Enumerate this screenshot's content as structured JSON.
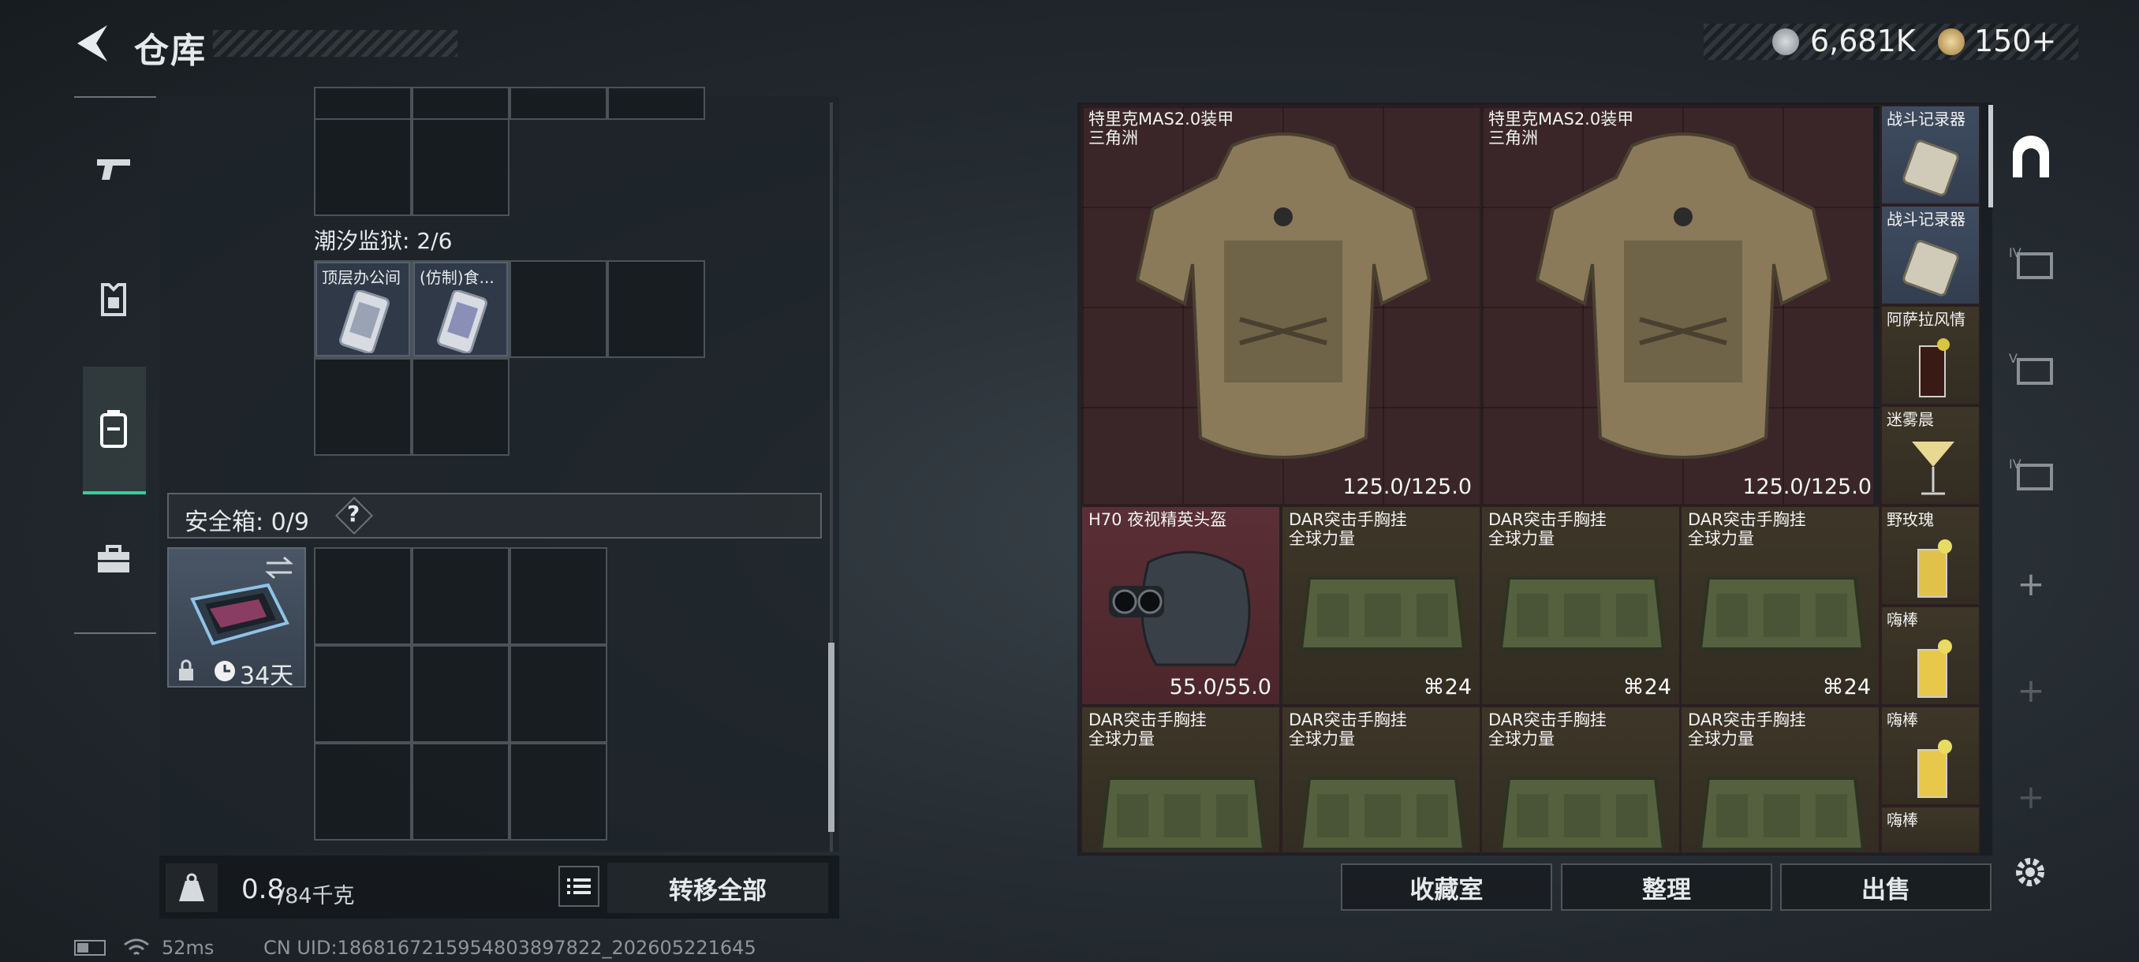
{
  "header": {
    "title": "仓库"
  },
  "currency": {
    "silver": "6,681K",
    "gold": "150+"
  },
  "mid": {
    "prison_label": "潮汐监狱: 2/6",
    "item1_label": "顶层办公间",
    "item2_label": "(仿制)食...",
    "safe_label": "安全箱: 0/9",
    "help": "?",
    "safe_timer": "34天"
  },
  "bottom": {
    "weight_value": "0.8",
    "weight_unit": "/84千克",
    "transfer_all": "转移全部"
  },
  "inventory": {
    "armor1_name": "特里克MAS2.0装甲",
    "armor1_sub": "三角洲",
    "armor1_dur": "125.0/125.0",
    "armor2_name": "特里克MAS2.0装甲",
    "armor2_sub": "三角洲",
    "armor2_dur": "125.0/125.0",
    "helmet_name": "H70 夜视精英头盔",
    "helmet_dur": "55.0/55.0",
    "rig_name": "DAR突击手胸挂",
    "rig_sub": "全球力量",
    "rig_count": "24",
    "recorder": "战斗记录器",
    "arasa": "阿萨拉风情",
    "mist": "迷雾晨",
    "rose": "野玫瑰",
    "hai": "嗨棒"
  },
  "footer": {
    "collection": "收藏室",
    "organize": "整理",
    "sell": "出售"
  },
  "status": {
    "ping": "52ms",
    "uid": "CN UID:1868167215954803897822_202605221645"
  },
  "colors": {
    "accent": "#2fd39a",
    "armor_bg": "#4b262b",
    "rig_bg": "#322c22"
  }
}
